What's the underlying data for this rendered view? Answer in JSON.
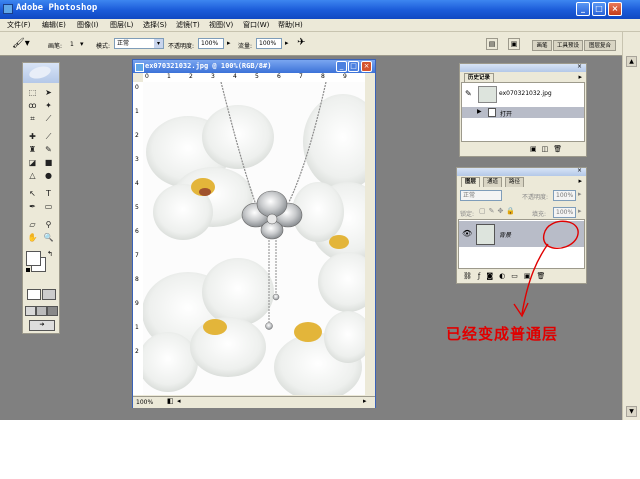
{
  "app": {
    "title": "Adobe Photoshop"
  },
  "menu": [
    "文件(F)",
    "编辑(E)",
    "图像(I)",
    "图层(L)",
    "选择(S)",
    "滤镜(T)",
    "视图(V)",
    "窗口(W)",
    "帮助(H)"
  ],
  "options": {
    "brush_label": "画笔:",
    "brush_size": "1",
    "mode_label": "模式:",
    "mode_value": "正常",
    "opacity_label": "不透明度:",
    "opacity_value": "100%",
    "flow_label": "流量:",
    "flow_value": "100%",
    "dock_tabs": [
      "画笔",
      "工具预设",
      "图层复合"
    ]
  },
  "document": {
    "title": "ex070321032.jpg @ 100%(RGB/8#)",
    "zoom": "100%",
    "ruler_top_ticks": [
      "0",
      "1",
      "2",
      "3",
      "4",
      "5",
      "6",
      "7",
      "8",
      "9"
    ],
    "ruler_left_ticks": [
      "0",
      "1",
      "2",
      "3",
      "4",
      "5",
      "6",
      "7",
      "8",
      "9",
      "1",
      "2"
    ]
  },
  "history_panel": {
    "tabs": [
      "历史记录"
    ],
    "snapshot_name": "ex070321032.jpg",
    "step": "打开"
  },
  "layers_panel": {
    "tabs": [
      "图层",
      "通道",
      "路径"
    ],
    "blend_mode": "正常",
    "opacity_label": "不透明度:",
    "opacity_value": "100%",
    "lock_label": "锁定:",
    "fill_label": "填充:",
    "fill_value": "100%",
    "layer_name": "背景"
  },
  "annotation": {
    "text": "已经变成普通层",
    "color": "#e00000"
  },
  "colors": {
    "xp_blue": "#1a5ad8",
    "workspace_gray": "#808080",
    "chrome": "#ece9d8"
  }
}
